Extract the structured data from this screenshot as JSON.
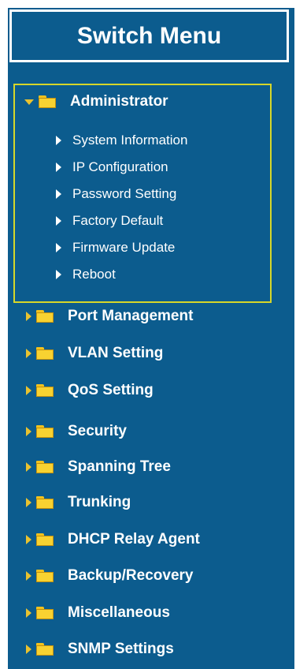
{
  "menu": {
    "title": "Switch Menu",
    "expanded": {
      "label": "Administrator",
      "children": [
        "System Information",
        "IP Configuration",
        "Password Setting",
        "Factory Default",
        "Firmware Update",
        "Reboot"
      ]
    },
    "items": [
      "Port Management",
      "VLAN Setting",
      "QoS Setting",
      "Security",
      "Spanning Tree",
      "Trunking",
      "DHCP Relay Agent",
      "Backup/Recovery",
      "Miscellaneous",
      "SNMP Settings"
    ]
  },
  "colors": {
    "background": "#0c5c8e",
    "text": "#ffffff",
    "highlight_border": "#d6d629",
    "folder": "#f8d231"
  }
}
